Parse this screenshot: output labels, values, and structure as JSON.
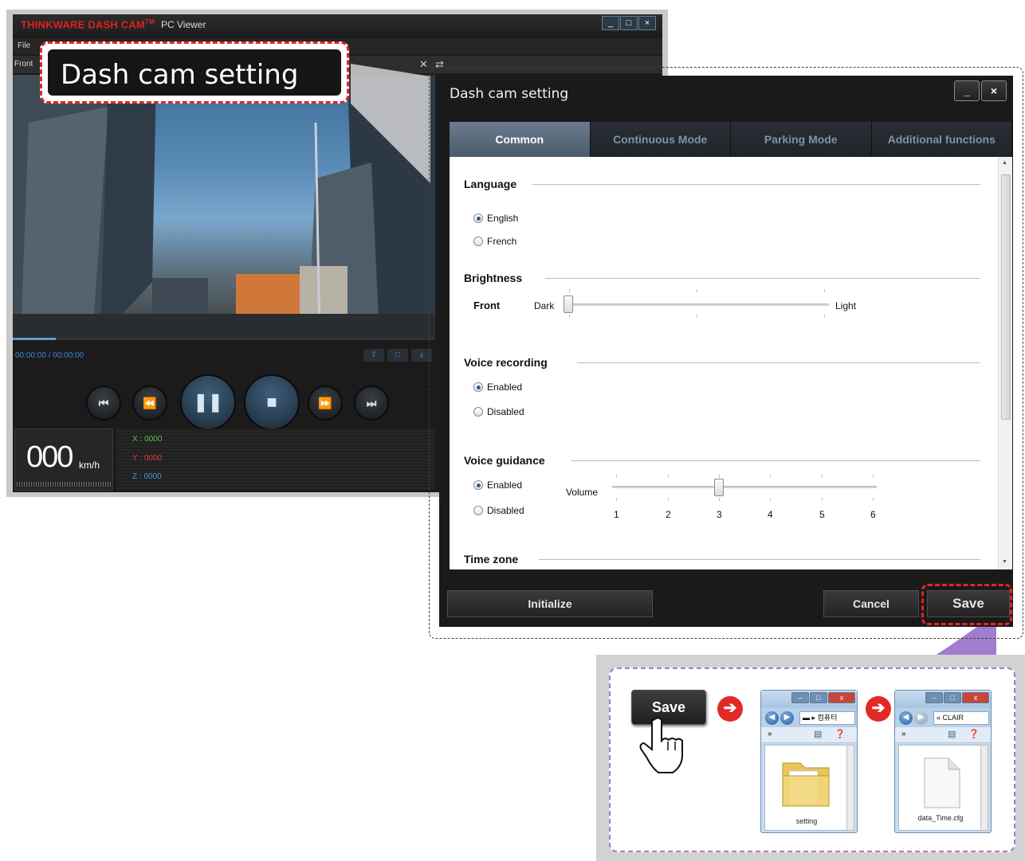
{
  "viewer": {
    "brand": "THINKWARE DASH CAM",
    "brand_tm": "TM",
    "subtitle": "PC Viewer",
    "window_buttons": [
      "_",
      "□",
      "×"
    ],
    "menu_file": "File",
    "front_label": "Front",
    "time": "00:00:00 / 00:00:00",
    "speed_value": "000",
    "speed_unit": "km/h",
    "g_x": "X : 0000",
    "g_y": "Y : 0000",
    "g_z": "Z : 0000",
    "progress_fraction": 0.1,
    "icons": [
      "expand-icon",
      "swap-icon",
      "screen-capture-icon",
      "display-icon",
      "download-icon"
    ],
    "playback_icons": [
      "skip-back-icon",
      "rewind-icon",
      "pause-icon",
      "stop-icon",
      "fast-forward-icon",
      "skip-forward-icon"
    ]
  },
  "callout_title": "Dash cam setting",
  "dialog": {
    "title": "Dash cam setting",
    "minimize": "_",
    "close": "×",
    "tabs": [
      "Common",
      "Continuous Mode",
      "Parking Mode",
      "Additional functions"
    ],
    "active_tab": "Common",
    "language": {
      "heading": "Language",
      "options": [
        "English",
        "French"
      ],
      "selected": "English"
    },
    "brightness": {
      "heading": "Brightness",
      "row_label": "Front",
      "min_label": "Dark",
      "max_label": "Light",
      "level_fraction": 0.0
    },
    "voice_recording": {
      "heading": "Voice recording",
      "options": [
        "Enabled",
        "Disabled"
      ],
      "selected": "Enabled"
    },
    "voice_guidance": {
      "heading": "Voice guidance",
      "options": [
        "Enabled",
        "Disabled"
      ],
      "selected": "Enabled",
      "volume_label": "Volume",
      "volume_ticks": [
        "1",
        "2",
        "3",
        "4",
        "5",
        "6"
      ],
      "volume_value": 3
    },
    "time_zone": {
      "heading": "Time zone"
    },
    "initialize": "Initialize",
    "cancel": "Cancel",
    "save": "Save"
  },
  "flow": {
    "save": "Save",
    "explorer1_path": "컴퓨터",
    "explorer1_folder": "setting",
    "explorer2_path": "CLAIR",
    "explorer2_file": "data_Time.cfg",
    "nav_prefix": "»",
    "colors": {
      "arrow": "#e12a25",
      "frame": "#a27ccf"
    }
  },
  "colors": {
    "accent_red": "#e0262a",
    "tab_active": "#5a6b7c",
    "brand_red": "#e02020"
  }
}
